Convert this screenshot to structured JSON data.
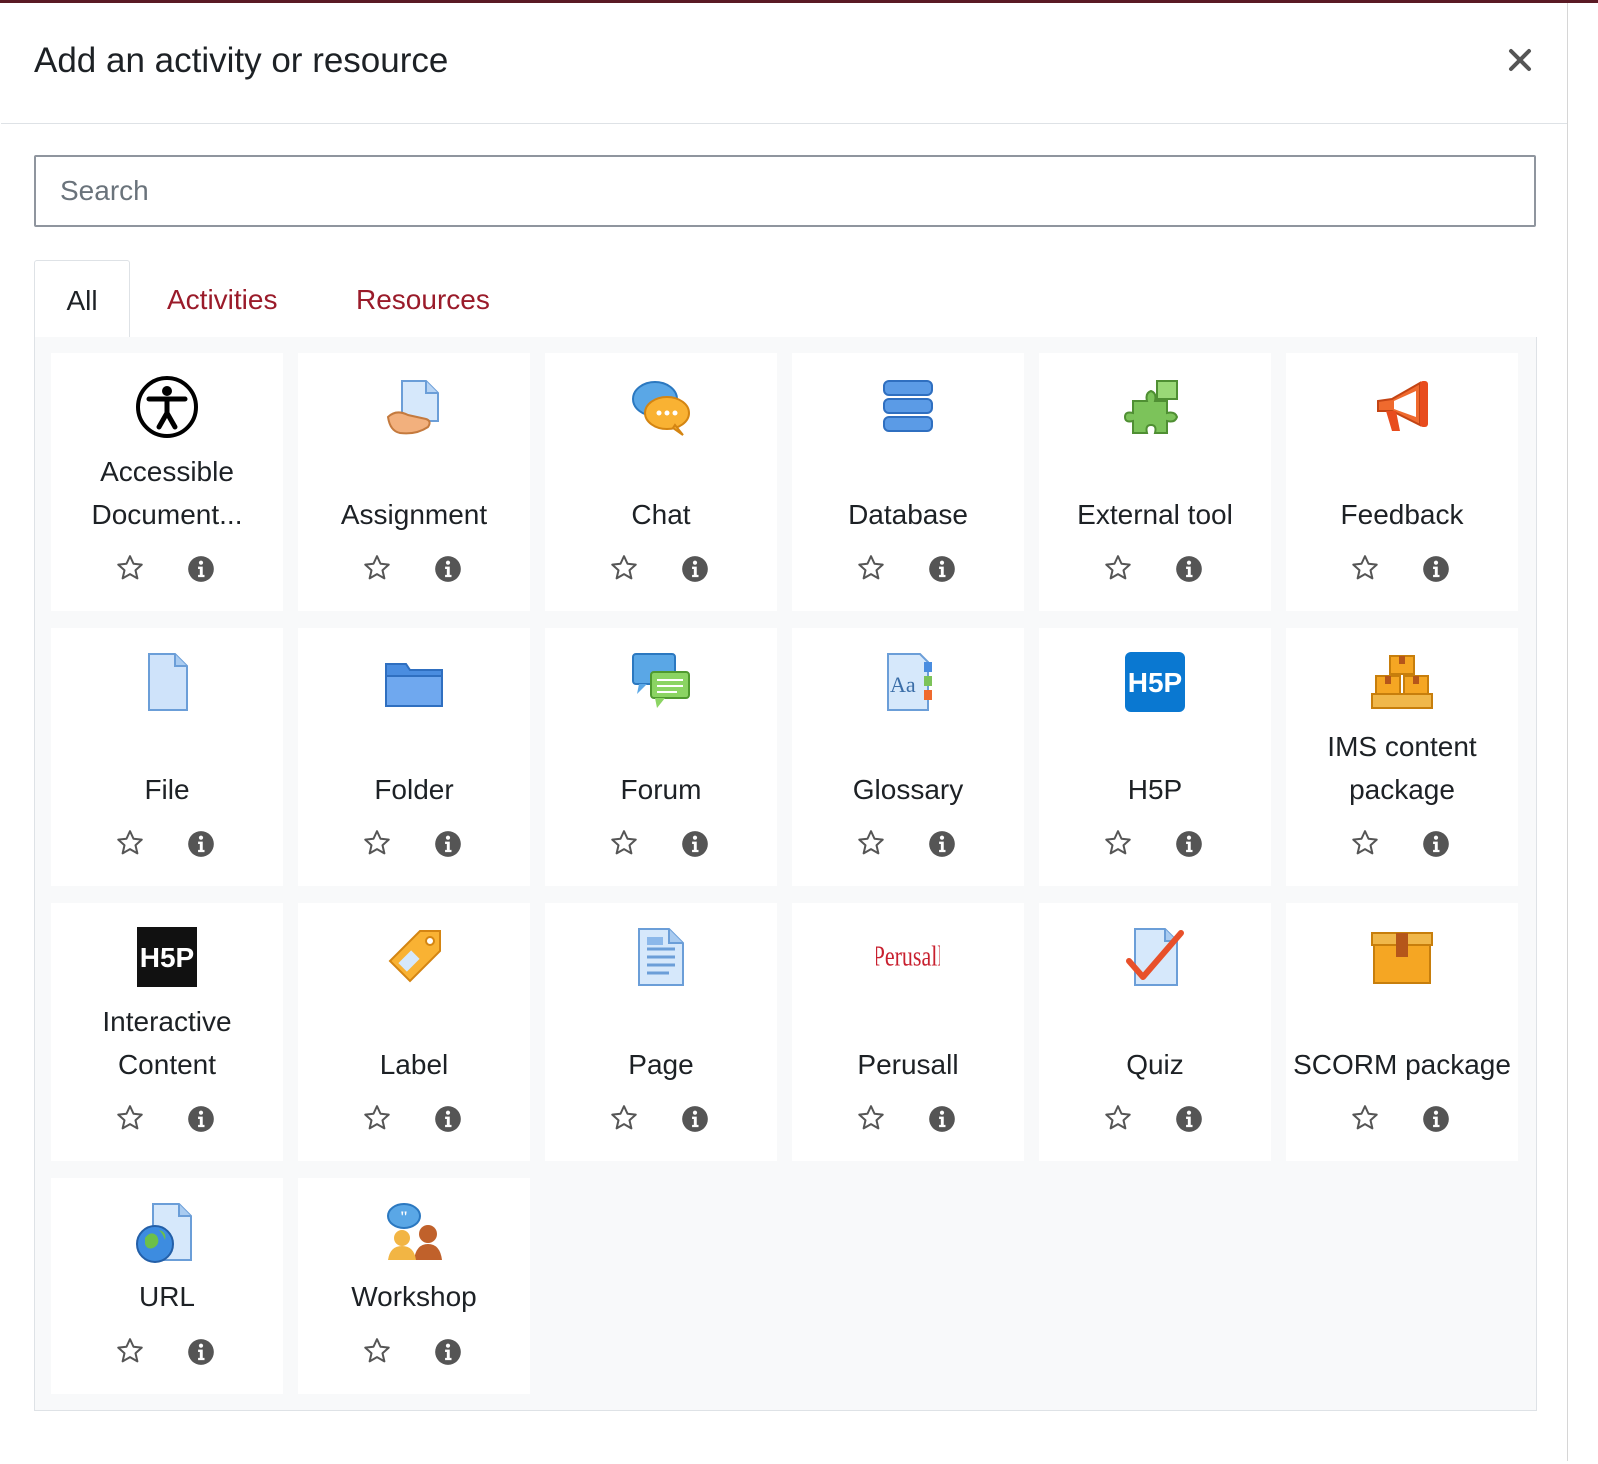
{
  "modal": {
    "title": "Add an activity or resource",
    "close_label": "×"
  },
  "search": {
    "placeholder": "Search"
  },
  "tabs": [
    {
      "label": "All",
      "active": true
    },
    {
      "label": "Activities",
      "active": false
    },
    {
      "label": "Resources",
      "active": false
    }
  ],
  "colors": {
    "link": "#9a1b2a",
    "panel_bg": "#f8f9fa",
    "card_bg": "#ffffff"
  },
  "items": [
    {
      "name": "Accessible Document...",
      "icon": "accessibility-icon"
    },
    {
      "name": "Assignment",
      "icon": "assignment-icon"
    },
    {
      "name": "Chat",
      "icon": "chat-icon"
    },
    {
      "name": "Database",
      "icon": "database-icon"
    },
    {
      "name": "External tool",
      "icon": "puzzle-icon"
    },
    {
      "name": "Feedback",
      "icon": "megaphone-icon"
    },
    {
      "name": "File",
      "icon": "file-icon"
    },
    {
      "name": "Folder",
      "icon": "folder-icon"
    },
    {
      "name": "Forum",
      "icon": "forum-icon"
    },
    {
      "name": "Glossary",
      "icon": "glossary-icon"
    },
    {
      "name": "H5P",
      "icon": "h5p-icon"
    },
    {
      "name": "IMS content package",
      "icon": "ims-package-icon"
    },
    {
      "name": "Interactive Content",
      "icon": "h5p-black-icon"
    },
    {
      "name": "Label",
      "icon": "label-tag-icon"
    },
    {
      "name": "Page",
      "icon": "page-icon"
    },
    {
      "name": "Perusall",
      "icon": "perusall-logo-icon",
      "logo_text": "Perusall"
    },
    {
      "name": "Quiz",
      "icon": "quiz-icon"
    },
    {
      "name": "SCORM package",
      "icon": "scorm-box-icon"
    },
    {
      "name": "URL",
      "icon": "url-globe-icon"
    },
    {
      "name": "Workshop",
      "icon": "workshop-icon"
    }
  ]
}
